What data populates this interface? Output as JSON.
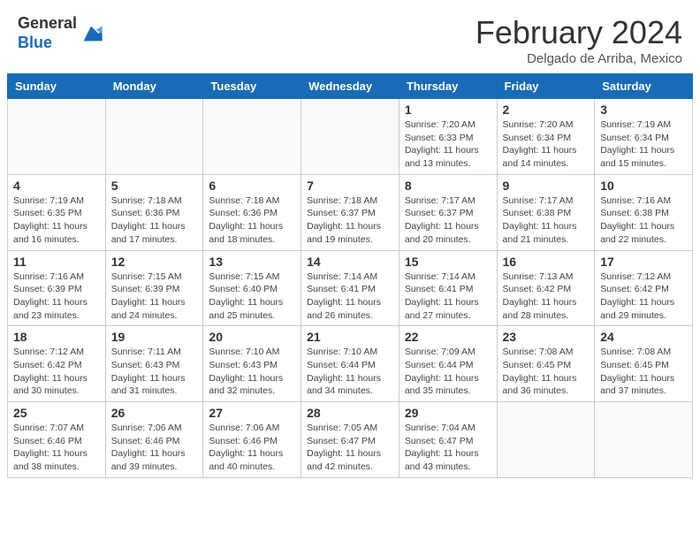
{
  "header": {
    "logo_general": "General",
    "logo_blue": "Blue",
    "month_title": "February 2024",
    "location": "Delgado de Arriba, Mexico"
  },
  "days_of_week": [
    "Sunday",
    "Monday",
    "Tuesday",
    "Wednesday",
    "Thursday",
    "Friday",
    "Saturday"
  ],
  "weeks": [
    [
      {
        "day": "",
        "info": ""
      },
      {
        "day": "",
        "info": ""
      },
      {
        "day": "",
        "info": ""
      },
      {
        "day": "",
        "info": ""
      },
      {
        "day": "1",
        "info": "Sunrise: 7:20 AM\nSunset: 6:33 PM\nDaylight: 11 hours\nand 13 minutes."
      },
      {
        "day": "2",
        "info": "Sunrise: 7:20 AM\nSunset: 6:34 PM\nDaylight: 11 hours\nand 14 minutes."
      },
      {
        "day": "3",
        "info": "Sunrise: 7:19 AM\nSunset: 6:34 PM\nDaylight: 11 hours\nand 15 minutes."
      }
    ],
    [
      {
        "day": "4",
        "info": "Sunrise: 7:19 AM\nSunset: 6:35 PM\nDaylight: 11 hours\nand 16 minutes."
      },
      {
        "day": "5",
        "info": "Sunrise: 7:18 AM\nSunset: 6:36 PM\nDaylight: 11 hours\nand 17 minutes."
      },
      {
        "day": "6",
        "info": "Sunrise: 7:18 AM\nSunset: 6:36 PM\nDaylight: 11 hours\nand 18 minutes."
      },
      {
        "day": "7",
        "info": "Sunrise: 7:18 AM\nSunset: 6:37 PM\nDaylight: 11 hours\nand 19 minutes."
      },
      {
        "day": "8",
        "info": "Sunrise: 7:17 AM\nSunset: 6:37 PM\nDaylight: 11 hours\nand 20 minutes."
      },
      {
        "day": "9",
        "info": "Sunrise: 7:17 AM\nSunset: 6:38 PM\nDaylight: 11 hours\nand 21 minutes."
      },
      {
        "day": "10",
        "info": "Sunrise: 7:16 AM\nSunset: 6:38 PM\nDaylight: 11 hours\nand 22 minutes."
      }
    ],
    [
      {
        "day": "11",
        "info": "Sunrise: 7:16 AM\nSunset: 6:39 PM\nDaylight: 11 hours\nand 23 minutes."
      },
      {
        "day": "12",
        "info": "Sunrise: 7:15 AM\nSunset: 6:39 PM\nDaylight: 11 hours\nand 24 minutes."
      },
      {
        "day": "13",
        "info": "Sunrise: 7:15 AM\nSunset: 6:40 PM\nDaylight: 11 hours\nand 25 minutes."
      },
      {
        "day": "14",
        "info": "Sunrise: 7:14 AM\nSunset: 6:41 PM\nDaylight: 11 hours\nand 26 minutes."
      },
      {
        "day": "15",
        "info": "Sunrise: 7:14 AM\nSunset: 6:41 PM\nDaylight: 11 hours\nand 27 minutes."
      },
      {
        "day": "16",
        "info": "Sunrise: 7:13 AM\nSunset: 6:42 PM\nDaylight: 11 hours\nand 28 minutes."
      },
      {
        "day": "17",
        "info": "Sunrise: 7:12 AM\nSunset: 6:42 PM\nDaylight: 11 hours\nand 29 minutes."
      }
    ],
    [
      {
        "day": "18",
        "info": "Sunrise: 7:12 AM\nSunset: 6:42 PM\nDaylight: 11 hours\nand 30 minutes."
      },
      {
        "day": "19",
        "info": "Sunrise: 7:11 AM\nSunset: 6:43 PM\nDaylight: 11 hours\nand 31 minutes."
      },
      {
        "day": "20",
        "info": "Sunrise: 7:10 AM\nSunset: 6:43 PM\nDaylight: 11 hours\nand 32 minutes."
      },
      {
        "day": "21",
        "info": "Sunrise: 7:10 AM\nSunset: 6:44 PM\nDaylight: 11 hours\nand 34 minutes."
      },
      {
        "day": "22",
        "info": "Sunrise: 7:09 AM\nSunset: 6:44 PM\nDaylight: 11 hours\nand 35 minutes."
      },
      {
        "day": "23",
        "info": "Sunrise: 7:08 AM\nSunset: 6:45 PM\nDaylight: 11 hours\nand 36 minutes."
      },
      {
        "day": "24",
        "info": "Sunrise: 7:08 AM\nSunset: 6:45 PM\nDaylight: 11 hours\nand 37 minutes."
      }
    ],
    [
      {
        "day": "25",
        "info": "Sunrise: 7:07 AM\nSunset: 6:46 PM\nDaylight: 11 hours\nand 38 minutes."
      },
      {
        "day": "26",
        "info": "Sunrise: 7:06 AM\nSunset: 6:46 PM\nDaylight: 11 hours\nand 39 minutes."
      },
      {
        "day": "27",
        "info": "Sunrise: 7:06 AM\nSunset: 6:46 PM\nDaylight: 11 hours\nand 40 minutes."
      },
      {
        "day": "28",
        "info": "Sunrise: 7:05 AM\nSunset: 6:47 PM\nDaylight: 11 hours\nand 42 minutes."
      },
      {
        "day": "29",
        "info": "Sunrise: 7:04 AM\nSunset: 6:47 PM\nDaylight: 11 hours\nand 43 minutes."
      },
      {
        "day": "",
        "info": ""
      },
      {
        "day": "",
        "info": ""
      }
    ]
  ]
}
